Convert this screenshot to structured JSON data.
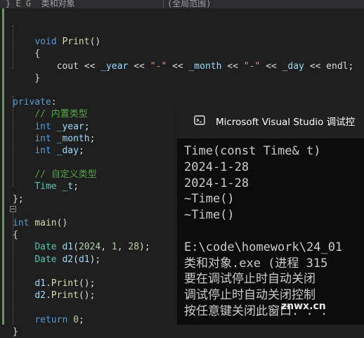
{
  "editor": {
    "tabs": [
      "}_E_G_ 类和对象",
      "(全局范围)"
    ],
    "lines": [
      [],
      [
        {
          "t": "    "
        },
        {
          "t": "void",
          "c": "kw"
        },
        {
          "t": " "
        },
        {
          "t": "Print",
          "c": "fn"
        },
        {
          "t": "()"
        }
      ],
      [
        {
          "t": "    {"
        }
      ],
      [
        {
          "t": "        cout << "
        },
        {
          "t": "_year",
          "c": "vr"
        },
        {
          "t": " << "
        },
        {
          "t": "\"-\"",
          "c": "st"
        },
        {
          "t": " << "
        },
        {
          "t": "_month",
          "c": "vr"
        },
        {
          "t": " << "
        },
        {
          "t": "\"-\"",
          "c": "st"
        },
        {
          "t": " << "
        },
        {
          "t": "_day",
          "c": "vr"
        },
        {
          "t": " << endl;"
        }
      ],
      [
        {
          "t": "    }"
        }
      ],
      [],
      [
        {
          "t": "private",
          "c": "kw"
        },
        {
          "t": ":"
        }
      ],
      [
        {
          "t": "    "
        },
        {
          "t": "// 内置类型",
          "c": "cm"
        }
      ],
      [
        {
          "t": "    "
        },
        {
          "t": "int",
          "c": "kw"
        },
        {
          "t": " "
        },
        {
          "t": "_year",
          "c": "vr"
        },
        {
          "t": ";"
        }
      ],
      [
        {
          "t": "    "
        },
        {
          "t": "int",
          "c": "kw"
        },
        {
          "t": " "
        },
        {
          "t": "_month",
          "c": "vr"
        },
        {
          "t": ";"
        }
      ],
      [
        {
          "t": "    "
        },
        {
          "t": "int",
          "c": "kw"
        },
        {
          "t": " "
        },
        {
          "t": "_day",
          "c": "vr"
        },
        {
          "t": ";"
        }
      ],
      [],
      [
        {
          "t": "    "
        },
        {
          "t": "// 自定义类型",
          "c": "cm"
        }
      ],
      [
        {
          "t": "    "
        },
        {
          "t": "Time",
          "c": "ty"
        },
        {
          "t": " "
        },
        {
          "t": "_t",
          "c": "vr"
        },
        {
          "t": ";"
        }
      ],
      [
        {
          "t": "};"
        }
      ],
      [],
      [
        {
          "t": "int",
          "c": "kw"
        },
        {
          "t": " "
        },
        {
          "t": "main",
          "c": "fn"
        },
        {
          "t": "()"
        }
      ],
      [
        {
          "t": "{"
        }
      ],
      [
        {
          "t": "    "
        },
        {
          "t": "Date",
          "c": "ty"
        },
        {
          "t": " "
        },
        {
          "t": "d1",
          "c": "vr"
        },
        {
          "t": "("
        },
        {
          "t": "2024",
          "c": "nm"
        },
        {
          "t": ", "
        },
        {
          "t": "1",
          "c": "nm"
        },
        {
          "t": ", "
        },
        {
          "t": "28",
          "c": "nm"
        },
        {
          "t": ");"
        }
      ],
      [
        {
          "t": "    "
        },
        {
          "t": "Date",
          "c": "ty"
        },
        {
          "t": " "
        },
        {
          "t": "d2",
          "c": "vr"
        },
        {
          "t": "("
        },
        {
          "t": "d1",
          "c": "vr"
        },
        {
          "t": ");"
        }
      ],
      [],
      [
        {
          "t": "    "
        },
        {
          "t": "d1",
          "c": "vr"
        },
        {
          "t": "."
        },
        {
          "t": "Print",
          "c": "fn"
        },
        {
          "t": "();"
        }
      ],
      [
        {
          "t": "    "
        },
        {
          "t": "d2",
          "c": "vr"
        },
        {
          "t": "."
        },
        {
          "t": "Print",
          "c": "fn"
        },
        {
          "t": "();"
        }
      ],
      [],
      [
        {
          "t": "    "
        },
        {
          "t": "return",
          "c": "kw"
        },
        {
          "t": " "
        },
        {
          "t": "0",
          "c": "nm"
        },
        {
          "t": ";"
        }
      ],
      [
        {
          "t": "}"
        }
      ]
    ]
  },
  "console": {
    "title": "Microsoft Visual Studio 调试控",
    "output": [
      "Time(const Time& t)",
      "2024-1-28",
      "2024-1-28",
      "~Time()",
      "~Time()",
      "",
      "E:\\code\\homework\\24_01",
      "类和对象.exe (进程 315",
      "要在调试停止时自动关闭",
      "调试停止时自动关闭控制",
      "按任意键关闭此窗口. . ."
    ]
  },
  "watermark": "znwx.cn"
}
